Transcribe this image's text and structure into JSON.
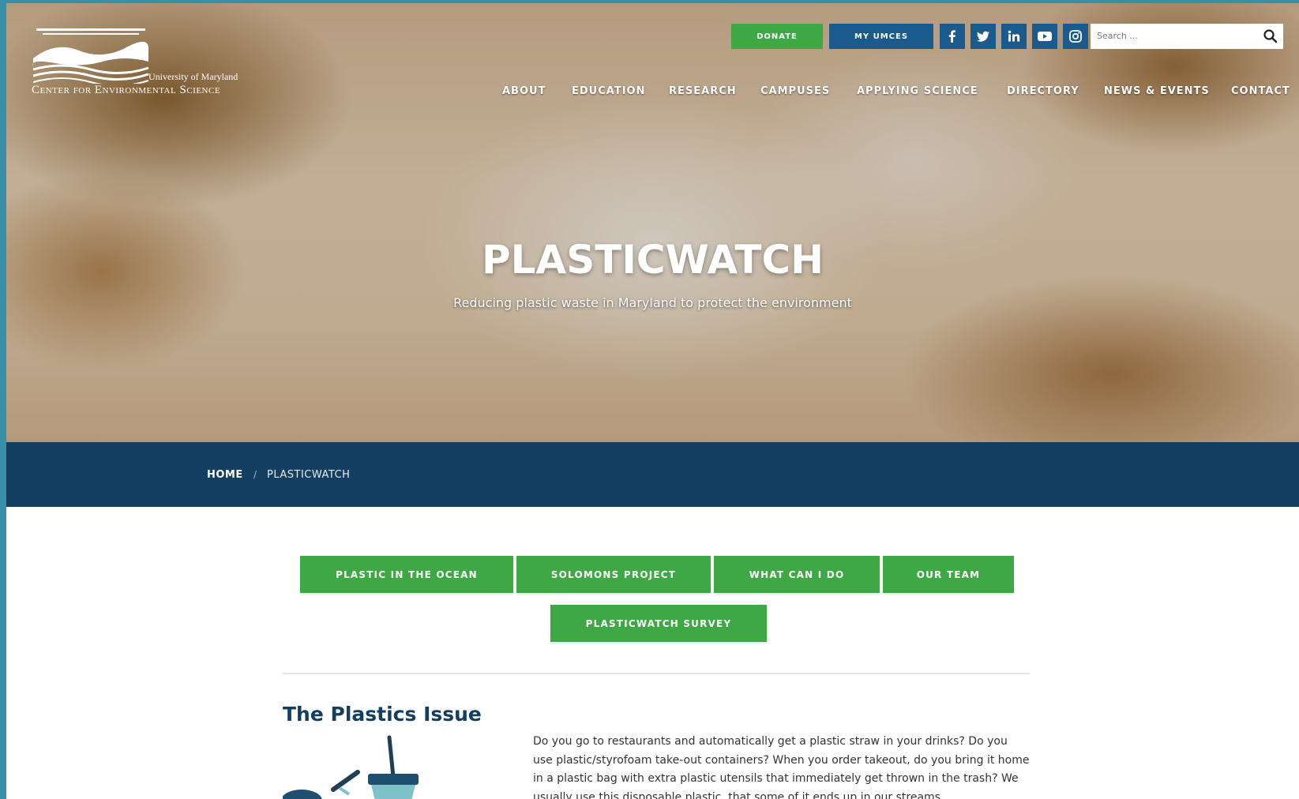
{
  "logo": {
    "small_text": "University of Maryland",
    "big_text": "Center for Environmental Science"
  },
  "utility": {
    "donate_label": "DONATE",
    "myunces_label": "MY UMCES",
    "social": [
      "facebook-icon",
      "twitter-icon",
      "linkedin-icon",
      "youtube-icon",
      "instagram-icon"
    ],
    "search_placeholder": "Search ..."
  },
  "nav": {
    "items": [
      "ABOUT",
      "EDUCATION",
      "RESEARCH",
      "CAMPUSES",
      "APPLYING SCIENCE",
      "DIRECTORY",
      "NEWS & EVENTS",
      "CONTACT"
    ]
  },
  "hero": {
    "title": "PLASTICWATCH",
    "subtitle": "Reducing plastic waste in Maryland to protect the environment"
  },
  "breadcrumb": {
    "home": "HOME",
    "separator": "/",
    "current": "PLASTICWATCH"
  },
  "sections": {
    "buttons": [
      "PLASTIC IN THE OCEAN",
      "SOLOMONS PROJECT",
      "WHAT CAN I DO",
      "OUR TEAM",
      "PLASTICWATCH SURVEY"
    ]
  },
  "issue": {
    "title": "The Plastics Issue",
    "body": "Do you go to restaurants and automatically get a plastic straw in your drinks? Do you use plastic/styrofoam take-out containers? When you order takeout, do you bring it home in a plastic bag with extra plastic utensils that immediately get thrown in the trash? We usually use this disposable plastic, that some of it ends up in our streams"
  },
  "colors": {
    "green": "#3ea845",
    "navy": "#153f60",
    "blue": "#1a5a8c"
  }
}
